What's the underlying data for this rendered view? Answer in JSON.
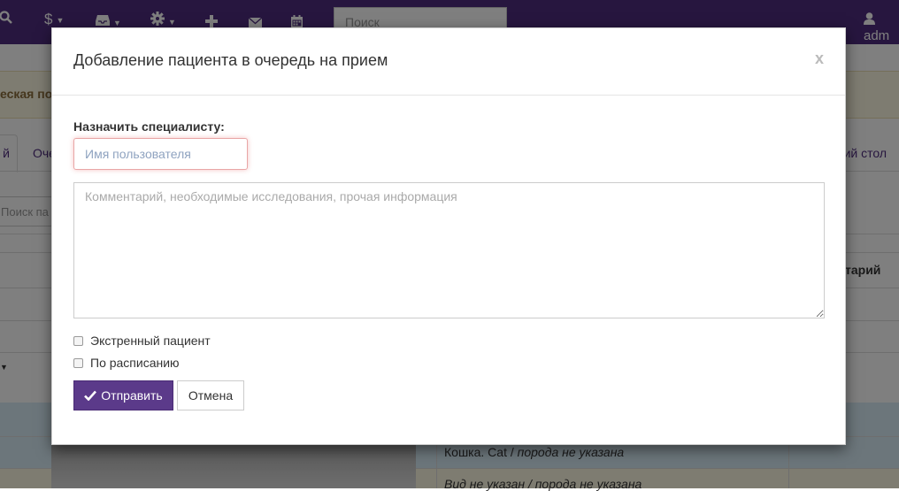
{
  "navbar": {
    "search_icon": "search-icon",
    "dollar": "$",
    "search_placeholder": "Поиск",
    "user": "adm"
  },
  "background": {
    "alert_text": "еская по",
    "tab_active": "й",
    "tab_queue": "Оче",
    "tab_right": "ий стол",
    "search_placeholder": "Поиск па",
    "th_right": "тарий",
    "row_cat_species": "Кошка. Cat / ",
    "row_cat_breed": "порода не указана",
    "row_unknown": "Вид не указан / порода не указана"
  },
  "modal": {
    "title": "Добавление пациента в очередь на прием",
    "close": "x",
    "assign_label": "Назначить специалисту:",
    "user_placeholder": "Имя пользователя",
    "comment_placeholder": "Комментарий, необходимые исследования, прочая информация",
    "emergency_label": "Экстренный пациент",
    "schedule_label": "По расписанию",
    "submit_label": "Отправить",
    "cancel_label": "Отмена"
  },
  "colors": {
    "navbar": "#4f2d7f",
    "primary_button": "#5b3a8a",
    "row_info": "#d9edf7",
    "row_warning": "#fcf8e3"
  }
}
